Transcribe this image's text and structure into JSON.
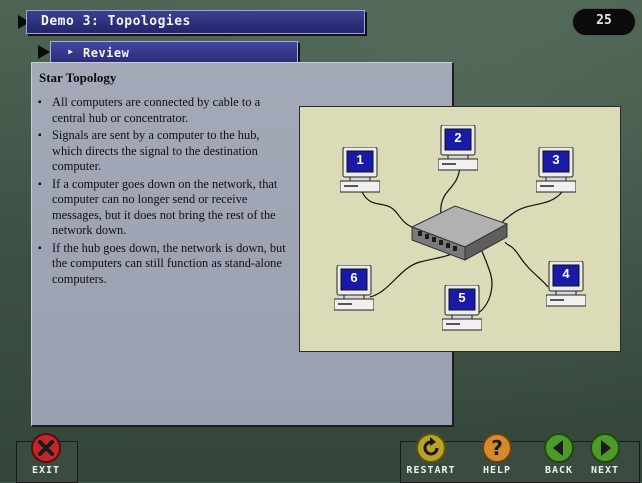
{
  "header": {
    "title": "Demo 3: Topologies",
    "page_number": "25",
    "section": "Review"
  },
  "content": {
    "heading": "Star Topology",
    "bullets": [
      "All computers are connected by cable to a central hub or concentrator.",
      "Signals are sent by a computer to the hub, which directs the signal to the destination computer.",
      "If a computer goes down on the network, that computer can no longer send or receive messages, but it does not bring the rest of the network down.",
      "If the hub goes down, the network is down, but the computers can still function as stand-alone computers."
    ]
  },
  "diagram": {
    "computers": [
      "1",
      "2",
      "3",
      "4",
      "5",
      "6"
    ],
    "colors": {
      "background": "#dcdbb7",
      "screen": "#1a1aa8",
      "hub": "#8d8d8d"
    }
  },
  "nav": {
    "exit": "EXIT",
    "restart": "RESTART",
    "help": "HELP",
    "back": "BACK",
    "next": "NEXT"
  },
  "colors": {
    "title_bar": "#2e3180",
    "panel": "#a0a6b5",
    "exit_icon": "#c0282c",
    "restart_icon": "#b8a22a",
    "help_icon": "#d4892a",
    "back_next_icon": "#4d9a2a"
  }
}
